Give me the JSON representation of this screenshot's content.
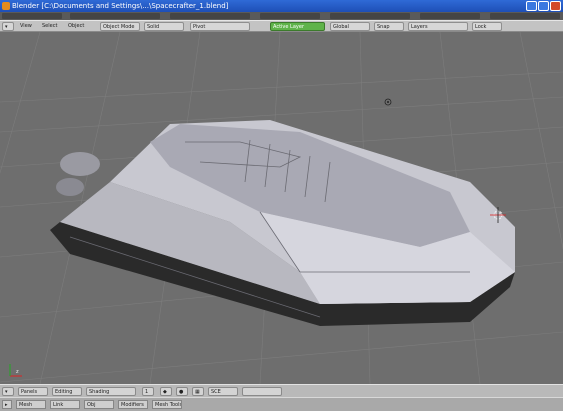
{
  "window": {
    "title": "Blender [C:\\Documents and Settings\\...\\Spacecrafter_1.blend]"
  },
  "view_header": {
    "view_menu": "View",
    "select_menu": "Select",
    "object_menu": "Object",
    "mode_select": "Object Mode",
    "draw_type": "Solid",
    "layer_active": "Active Layer",
    "tools": [
      "Pivot",
      "Global",
      "Snap",
      "Layers",
      "Lock"
    ]
  },
  "bottom_header": {
    "panels_label": "Panels",
    "editing_label": "Editing",
    "shading_label": "Shading",
    "frame_label": "1",
    "scene_field": "SCE"
  },
  "buttons_strip": {
    "items": [
      "Mesh",
      "Link",
      "Obj",
      "Modifiers",
      "Mesh Tools"
    ]
  },
  "axis": {
    "label": "z"
  }
}
